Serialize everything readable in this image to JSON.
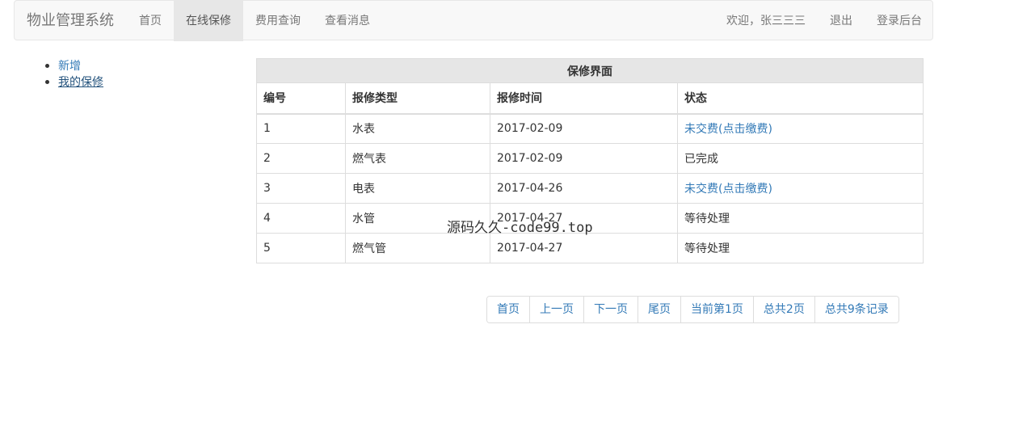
{
  "navbar": {
    "brand": "物业管理系统",
    "left_items": [
      "首页",
      "在线保修",
      "费用查询",
      "查看消息"
    ],
    "active_item": "在线保修",
    "welcome": "欢迎，张三三三",
    "logout": "退出",
    "admin_login": "登录后台"
  },
  "sidebar": {
    "items": [
      {
        "label": "新增"
      },
      {
        "label": "我的保修"
      }
    ]
  },
  "table": {
    "caption": "保修界面",
    "headers": [
      "编号",
      "报修类型",
      "报修时间",
      "状态"
    ],
    "rows": [
      {
        "id": "1",
        "type": "水表",
        "time": "2017-02-09",
        "status": "未交费(点击缴费)"
      },
      {
        "id": "2",
        "type": "燃气表",
        "time": "2017-02-09",
        "status": "已完成"
      },
      {
        "id": "3",
        "type": "电表",
        "time": "2017-04-26",
        "status": "未交费(点击缴费)"
      },
      {
        "id": "4",
        "type": "水管",
        "time": "2017-04-27",
        "status": "等待处理"
      },
      {
        "id": "5",
        "type": "燃气管",
        "time": "2017-04-27",
        "status": "等待处理"
      }
    ]
  },
  "watermark": "源码久久-code99.top",
  "pagination": {
    "first": "首页",
    "prev": "上一页",
    "next": "下一页",
    "last": "尾页",
    "current_page": "当前第1页",
    "total_pages": "总共2页",
    "total_records": "总共9条记录"
  },
  "colors": {
    "link": "#337ab7",
    "navbar_bg": "#f8f8f8",
    "active_nav_bg": "#e7e7e7",
    "caption_bg": "#e6e6e6"
  }
}
